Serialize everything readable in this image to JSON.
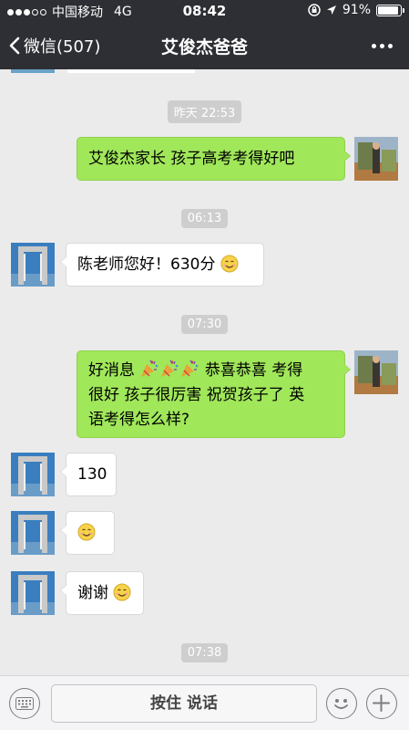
{
  "status_bar": {
    "carrier": "中国移动",
    "network": "4G",
    "time": "08:42",
    "battery": "91%",
    "battery_level": 0.91
  },
  "nav": {
    "back_label": "微信(507)",
    "title": "艾俊杰爸爸"
  },
  "chat": {
    "timestamps": [
      "昨天 22:53",
      "06:13",
      "07:30",
      "07:38"
    ],
    "messages": [
      {
        "side": "right",
        "text": "艾俊杰家长 孩子高考考得好吧"
      },
      {
        "side": "left",
        "text": "陈老师您好！630分",
        "emoji": "smile-emoji"
      },
      {
        "side": "right",
        "text_a": "好消息",
        "emoji": "party-popper-emoji",
        "emoji_count": 3,
        "text_b": "恭喜恭喜 考得",
        "line2": "很好 孩子很厉害 祝贺孩子了 英",
        "line3": "语考得怎么样?"
      },
      {
        "side": "left",
        "text": "130"
      },
      {
        "side": "left",
        "text": "",
        "emoji": "smile-emoji"
      },
      {
        "side": "left",
        "text": "谢谢",
        "emoji": "smile-emoji"
      }
    ]
  },
  "input_bar": {
    "voice_label": "按住 说话",
    "icons": [
      "keyboard-icon",
      "emoji-icon",
      "plus-icon"
    ]
  },
  "colors": {
    "nav_bg": "#2e2f34",
    "chat_bg": "#ebebeb",
    "sent_bubble": "#a0e75a",
    "received_bubble": "#ffffff"
  }
}
